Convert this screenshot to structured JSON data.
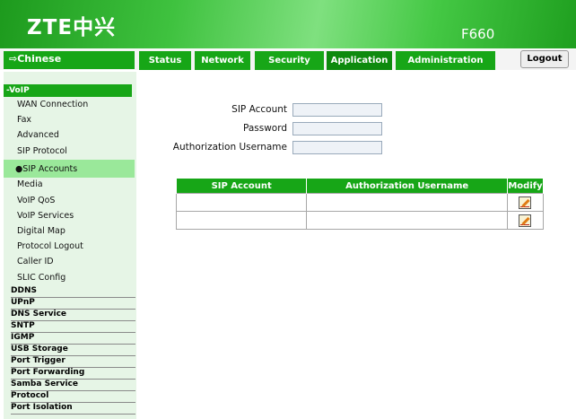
{
  "header": {
    "logo": "ZTE中兴",
    "model": "F660"
  },
  "nav": {
    "language": "⇨Chinese",
    "tabs": [
      "Status",
      "Network",
      "Security",
      "Application",
      "Administration"
    ],
    "active_tab": "Application",
    "logout": "Logout"
  },
  "sidebar": {
    "section": "-VoIP",
    "sub_items": [
      "WAN Connection",
      "Fax",
      "Advanced",
      "SIP Protocol",
      "●SIP Accounts",
      "Media",
      "VoIP QoS",
      "VoIP Services",
      "Digital Map",
      "Protocol Logout",
      "Caller ID",
      "SLIC Config"
    ],
    "selected_sub": "●SIP Accounts",
    "top_items": [
      "DDNS",
      "UPnP",
      "DNS Service",
      "SNTP",
      "IGMP",
      "USB Storage",
      "Port Trigger",
      "Port Forwarding",
      "Samba Service",
      "Protocol",
      "Port Isolation"
    ]
  },
  "form": {
    "sip_account_label": "SIP Account",
    "sip_account_value": "",
    "password_label": "Password",
    "password_value": "",
    "auth_username_label": "Authorization Username",
    "auth_username_value": ""
  },
  "table": {
    "headers": [
      "SIP Account",
      "Authorization Username",
      "Modify"
    ],
    "rows": [
      [
        "",
        ""
      ],
      [
        "",
        ""
      ]
    ]
  },
  "colors": {
    "brand_green": "#17a617",
    "selected_sub_bg": "#9ae89a",
    "sidebar_bg": "#e6f5e6"
  },
  "icons": {
    "modify": "edit-pencil-icon"
  }
}
